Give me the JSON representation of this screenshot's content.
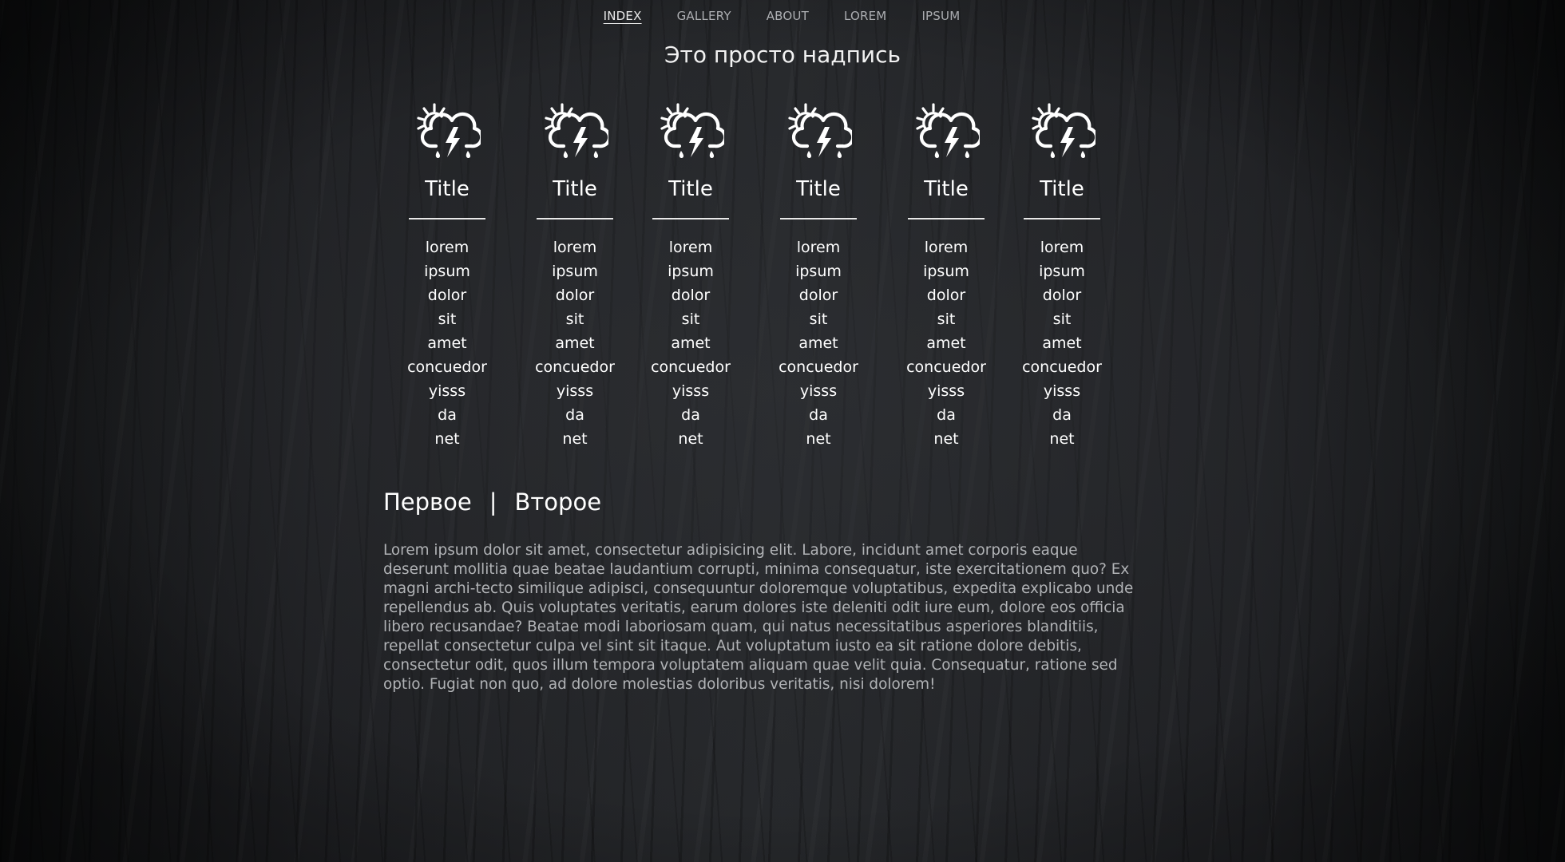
{
  "nav": {
    "items": [
      {
        "label": "INDEX",
        "active": true
      },
      {
        "label": "GALLERY",
        "active": false
      },
      {
        "label": "ABOUT",
        "active": false
      },
      {
        "label": "LOREM",
        "active": false
      },
      {
        "label": "IPSUM",
        "active": false
      }
    ]
  },
  "heading": "Это просто надпись",
  "columns": [
    {
      "icon": "weather-storm-sun-icon",
      "title": "Title",
      "items": [
        "lorem",
        "ipsum",
        "dolor",
        "sit",
        "amet",
        "concuedor",
        "yisss",
        "da",
        "net"
      ]
    },
    {
      "icon": "weather-storm-sun-icon",
      "title": "Title",
      "items": [
        "lorem",
        "ipsum",
        "dolor",
        "sit",
        "amet",
        "concuedor",
        "yisss",
        "da",
        "net"
      ]
    },
    {
      "icon": "weather-storm-sun-icon",
      "title": "Title",
      "items": [
        "lorem",
        "ipsum",
        "dolor",
        "sit",
        "amet",
        "concuedor",
        "yisss",
        "da",
        "net"
      ]
    },
    {
      "icon": "weather-storm-sun-icon",
      "title": "Title",
      "items": [
        "lorem",
        "ipsum",
        "dolor",
        "sit",
        "amet",
        "concuedor",
        "yisss",
        "da",
        "net"
      ]
    },
    {
      "icon": "weather-storm-sun-icon",
      "title": "Title",
      "items": [
        "lorem",
        "ipsum",
        "dolor",
        "sit",
        "amet",
        "concuedor",
        "yisss",
        "da",
        "net"
      ]
    },
    {
      "icon": "weather-storm-sun-icon",
      "title": "Title",
      "items": [
        "lorem",
        "ipsum",
        "dolor",
        "sit",
        "amet",
        "concuedor",
        "yisss",
        "da",
        "net"
      ]
    }
  ],
  "tabs": {
    "first": "Первое",
    "separator": "|",
    "second": "Второе"
  },
  "paragraph": "Lorem ipsum dolor sit amet, consectetur adipisicing elit. Labore, incidunt amet corporis eaque deserunt mollitia quae beatae laudantium corrupti, minima consequatur, iste exercitationem quo? Ex magni archi-tecto similique adipisci, consequuntur doloremque voluptatibus, expedita explicabo unde repellendus ab. Quis voluptates veritatis, earum dolores iste deleniti odit iure eum, dolore eos officia libero recusandae? Beatae modi laboriosam quam, qui natus necessitatibus asperiores blanditiis, repellat consectetur culpa vel sint sit itaque. Aut voluptatum iusto ea sit ratione dolore debitis, consectetur odit, quos illum tempora voluptatem aliquam quae velit quia. Consequatur, ratione sed optio. Fugiat non quo, ad dolore molestias doloribus veritatis, nisi dolorem!",
  "colors": {
    "text": "#ffffff",
    "muted": "#b1b3b6",
    "nav_inactive": "#b9bbbf",
    "background": "#1b1c1e"
  }
}
